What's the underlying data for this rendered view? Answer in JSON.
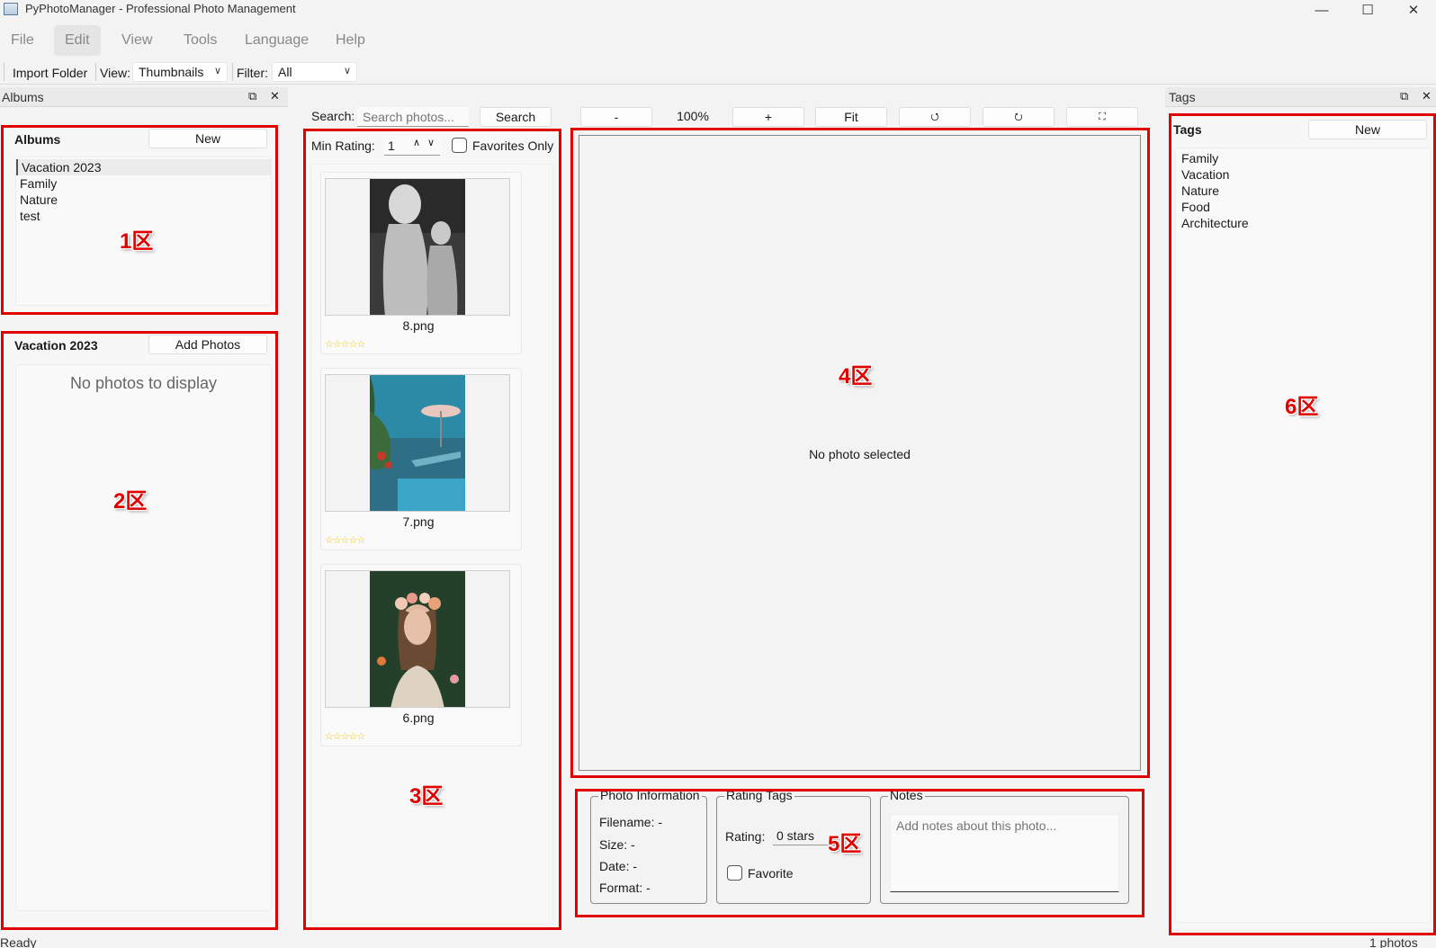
{
  "window": {
    "title": "PyPhotoManager - Professional Photo Management",
    "controls": [
      "—",
      "☐",
      "✕"
    ]
  },
  "menu": [
    "File",
    "Edit",
    "View",
    "Tools",
    "Language",
    "Help"
  ],
  "toolbar": {
    "import_label": "Import Folder",
    "view_label": "View:",
    "view_value": "Thumbnails",
    "filter_label": "Filter:",
    "filter_value": "All"
  },
  "albums_dock": {
    "title": "Albums",
    "section_title": "Albums",
    "new_button": "New",
    "items": [
      "Vacation 2023",
      "Family",
      "Nature",
      "test"
    ],
    "selected": "Vacation 2023"
  },
  "album_view": {
    "title": "Vacation 2023",
    "add_button": "Add Photos",
    "empty_text": "No photos to display"
  },
  "browser": {
    "search_label": "Search:",
    "search_placeholder": "Search photos...",
    "search_button": "Search",
    "min_rating_label": "Min Rating:",
    "min_rating_value": "1",
    "favorites_label": "Favorites Only",
    "photos": [
      {
        "name": "8.png",
        "stars": "☆☆☆☆☆"
      },
      {
        "name": "7.png",
        "stars": "☆☆☆☆☆"
      },
      {
        "name": "6.png",
        "stars": "☆☆☆☆☆"
      }
    ]
  },
  "viewer": {
    "zoom_out": "-",
    "zoom_level": "100%",
    "zoom_in": "+",
    "fit": "Fit",
    "rotate_left": "⭯",
    "rotate_right": "⭮",
    "fullscreen": "⛶",
    "empty_text": "No photo selected"
  },
  "info": {
    "photo_info_title": "Photo Information",
    "filename": "Filename: -",
    "size": "Size: -",
    "date": "Date: -",
    "format": "Format: -",
    "rating_title": "Rating  Tags",
    "rating_label": "Rating:",
    "rating_value": "0 stars",
    "favorite_label": "Favorite",
    "notes_title": "Notes",
    "notes_placeholder": "Add notes about this photo..."
  },
  "tags_dock": {
    "title": "Tags",
    "section_title": "Tags",
    "new_button": "New",
    "items": [
      "Family",
      "Vacation",
      "Nature",
      "Food",
      "Architecture"
    ]
  },
  "zones": [
    "1区",
    "2区",
    "3区",
    "4区",
    "5区",
    "6区"
  ],
  "status": {
    "left": "Ready",
    "right": "1 photos"
  },
  "colors": {
    "annotation": "#e00000",
    "star": "#f0c400",
    "background": "#f3f3f3"
  }
}
